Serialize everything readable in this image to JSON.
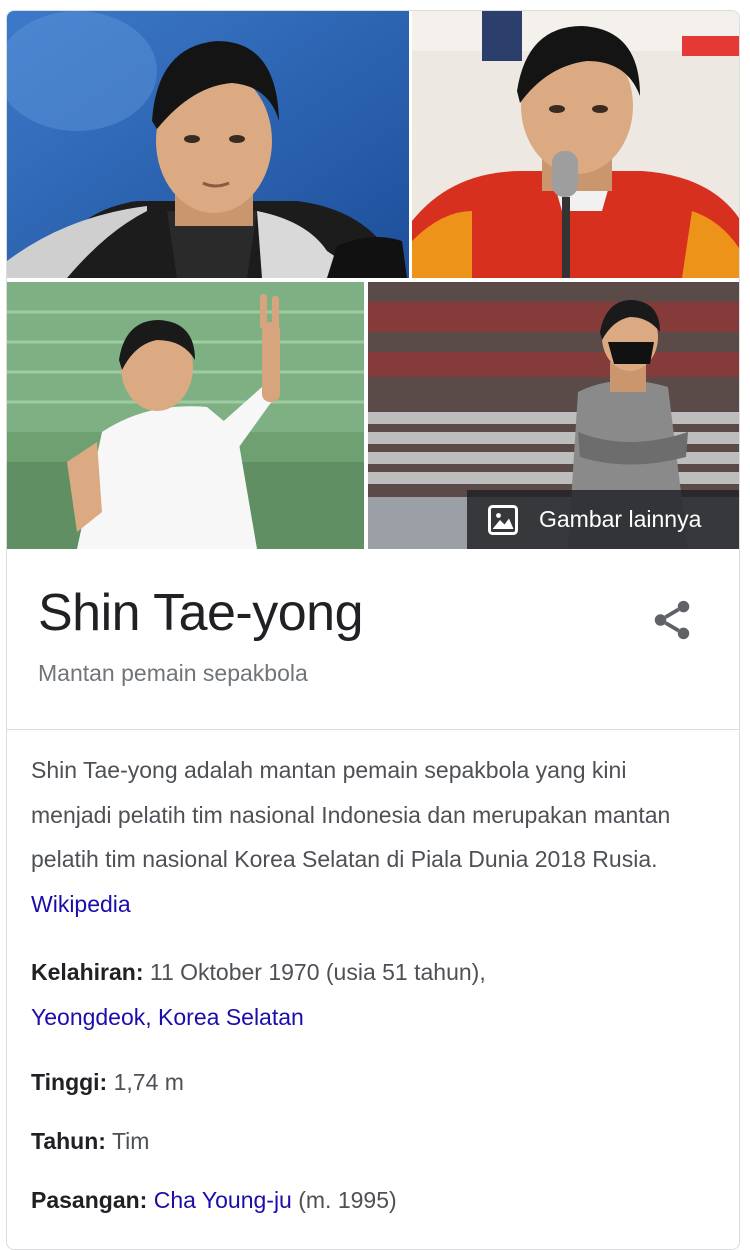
{
  "images": {
    "more_label": "Gambar lainnya",
    "photos": [
      {
        "icon": "photo-portrait-scarf"
      },
      {
        "icon": "photo-press-conference"
      },
      {
        "icon": "photo-gesture-field"
      },
      {
        "icon": "photo-stadium-masked"
      }
    ]
  },
  "header": {
    "title": "Shin Tae-yong",
    "subtitle": "Mantan pemain sepakbola"
  },
  "description": {
    "text": "Shin Tae-yong adalah mantan pemain sepakbola yang kini menjadi pelatih tim nasional Indonesia dan merupakan mantan pelatih tim nasional Korea Selatan di Piala Dunia 2018 Rusia.",
    "source": "Wikipedia"
  },
  "facts": {
    "birth": {
      "label": "Kelahiran:",
      "value": "11 Oktober 1970 (usia 51 tahun),",
      "link": "Yeongdeok, Korea Selatan"
    },
    "height": {
      "label": "Tinggi:",
      "value": "1,74 m"
    },
    "years": {
      "label": "Tahun:",
      "value": "Tim"
    },
    "spouse": {
      "label": "Pasangan:",
      "link": "Cha Young-ju",
      "value": "(m. 1995)"
    }
  },
  "colors": {
    "link": "#1a0dab",
    "title": "#202124",
    "secondary": "#70757a",
    "body": "#4d5156"
  }
}
